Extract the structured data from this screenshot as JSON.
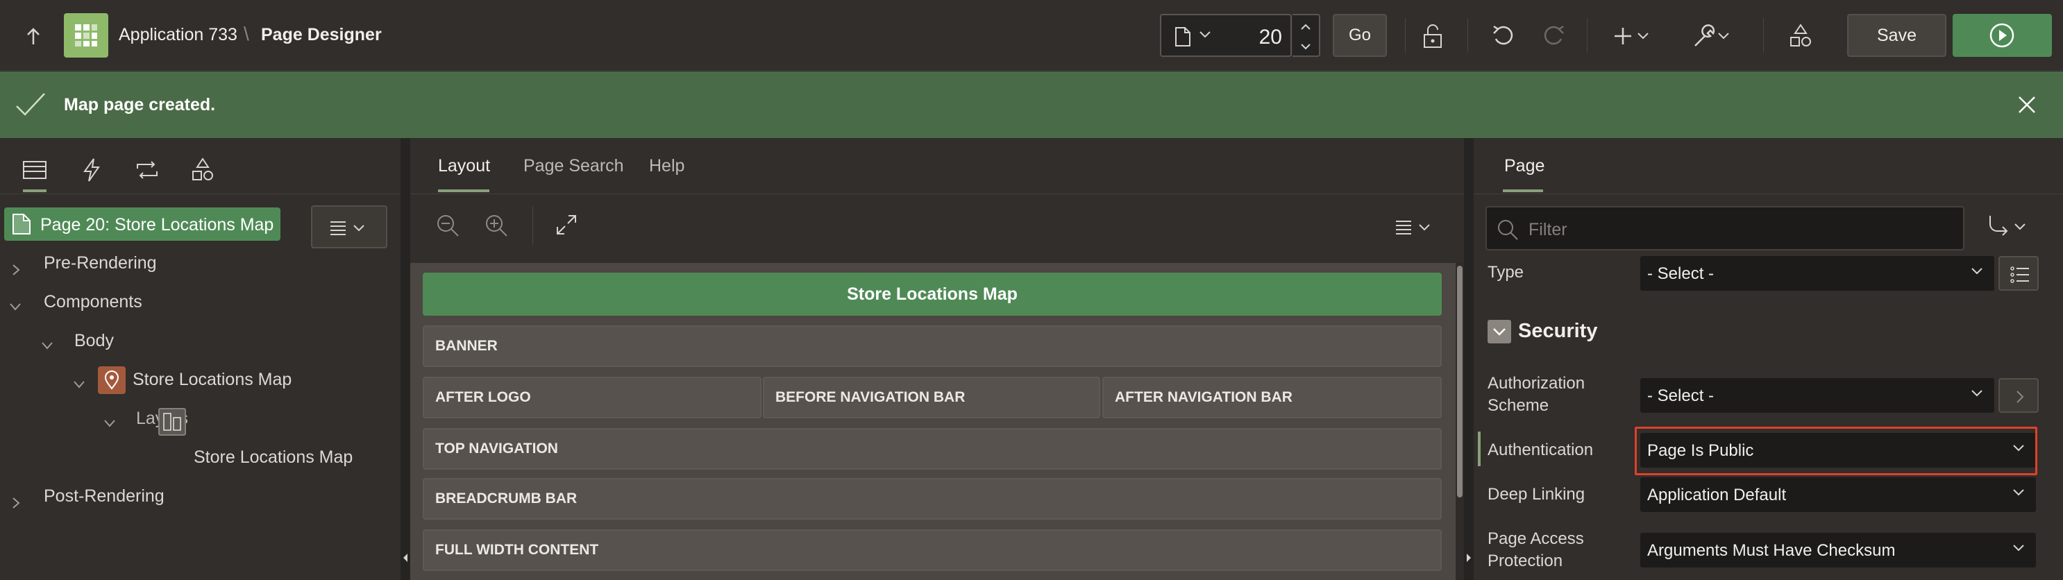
{
  "header": {
    "app_name": "Application 733",
    "separator": "\\",
    "page_title": "Page Designer",
    "page_number": "20",
    "go_label": "Go",
    "save_label": "Save"
  },
  "banner": {
    "message": "Map page created."
  },
  "left_panel": {
    "tabs": [
      "rendering-tab",
      "dynamic-actions-tab",
      "processing-tab",
      "shared-components-tab"
    ],
    "tree": {
      "root": "Page 20: Store Locations Map",
      "pre_rendering": "Pre-Rendering",
      "components": "Components",
      "body": "Body",
      "map_region": "Store Locations Map",
      "layers": "Layers",
      "layer": "Store Locations Map",
      "post_rendering": "Post-Rendering"
    }
  },
  "center_panel": {
    "tabs": [
      "Layout",
      "Page Search",
      "Help"
    ],
    "region_title": "Store Locations Map",
    "slots": {
      "banner": "BANNER",
      "after_logo": "AFTER LOGO",
      "before_nav": "BEFORE NAVIGATION BAR",
      "after_nav": "AFTER NAVIGATION BAR",
      "top_nav": "TOP NAVIGATION",
      "breadcrumb": "BREADCRUMB BAR",
      "full_width": "FULL WIDTH CONTENT"
    }
  },
  "right_panel": {
    "tab": "Page",
    "filter_placeholder": "Filter",
    "type": {
      "label": "Type",
      "value": "- Select -"
    },
    "section": "Security",
    "authorization": {
      "label_line1": "Authorization",
      "label_line2": "Scheme",
      "value": "- Select -"
    },
    "authentication": {
      "label": "Authentication",
      "value": "Page Is Public"
    },
    "deep_linking": {
      "label": "Deep Linking",
      "value": "Application Default"
    },
    "page_access": {
      "label_line1": "Page Access",
      "label_line2": "Protection",
      "value": "Arguments Must Have Checksum"
    }
  },
  "colors": {
    "accent_green": "#4f8a56",
    "banner_green": "#4a6b47",
    "highlight_red": "#e0412a",
    "app_logo": "#8fba6a"
  }
}
